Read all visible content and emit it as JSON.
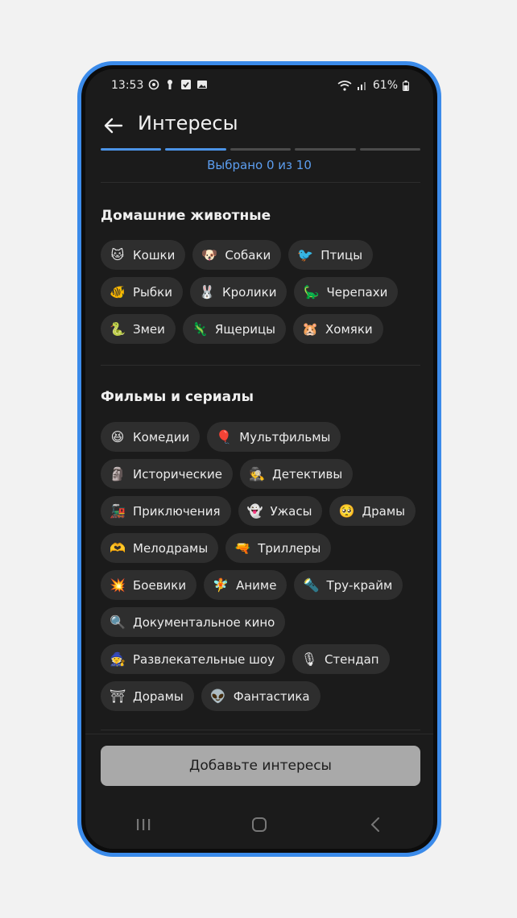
{
  "status_bar": {
    "time": "13:53",
    "left_icons": [
      "sync-icon",
      "key-icon",
      "checkbox-icon",
      "image-icon"
    ],
    "battery": "61%"
  },
  "header": {
    "title": "Интересы"
  },
  "progress": {
    "segments": 5,
    "active": 2,
    "counter_text": "Выбрано 0 из 10"
  },
  "sections": [
    {
      "title": "Домашние животные",
      "chips": [
        {
          "emoji": "🐱",
          "label": "Кошки"
        },
        {
          "emoji": "🐶",
          "label": "Собаки"
        },
        {
          "emoji": "🐦",
          "label": "Птицы"
        },
        {
          "emoji": "🐠",
          "label": "Рыбки"
        },
        {
          "emoji": "🐰",
          "label": "Кролики"
        },
        {
          "emoji": "🦕",
          "label": "Черепахи"
        },
        {
          "emoji": "🐍",
          "label": "Змеи"
        },
        {
          "emoji": "🦎",
          "label": "Ящерицы"
        },
        {
          "emoji": "🐹",
          "label": "Хомяки"
        }
      ]
    },
    {
      "title": "Фильмы и сериалы",
      "chips": [
        {
          "emoji": "😆",
          "label": "Комедии"
        },
        {
          "emoji": "🎈",
          "label": "Мультфильмы"
        },
        {
          "emoji": "🗿",
          "label": "Исторические"
        },
        {
          "emoji": "🕵",
          "label": "Детективы"
        },
        {
          "emoji": "🚂",
          "label": "Приключения"
        },
        {
          "emoji": "👻",
          "label": "Ужасы"
        },
        {
          "emoji": "🥺",
          "label": "Драмы"
        },
        {
          "emoji": "🫶",
          "label": "Мелодрамы"
        },
        {
          "emoji": "🔫",
          "label": "Триллеры"
        },
        {
          "emoji": "💥",
          "label": "Боевики"
        },
        {
          "emoji": "🧚",
          "label": "Аниме"
        },
        {
          "emoji": "🔦",
          "label": "Тру-крайм"
        },
        {
          "emoji": "🔍",
          "label": "Документальное кино"
        },
        {
          "emoji": "🧙",
          "label": "Развлекательные шоу"
        },
        {
          "emoji": "🎙",
          "label": "Стендап"
        },
        {
          "emoji": "⛩",
          "label": "Дорамы"
        },
        {
          "emoji": "👽",
          "label": "Фантастика"
        }
      ]
    }
  ],
  "footer": {
    "cta_label": "Добавьте интересы"
  },
  "navbar": {
    "items": [
      "recents-icon",
      "home-icon",
      "back-nav-icon"
    ]
  },
  "colors": {
    "accent": "#4b93e6",
    "frame": "#3b8bea",
    "chip_bg": "#2e2e2e",
    "cta_bg": "#a9a9a9"
  }
}
